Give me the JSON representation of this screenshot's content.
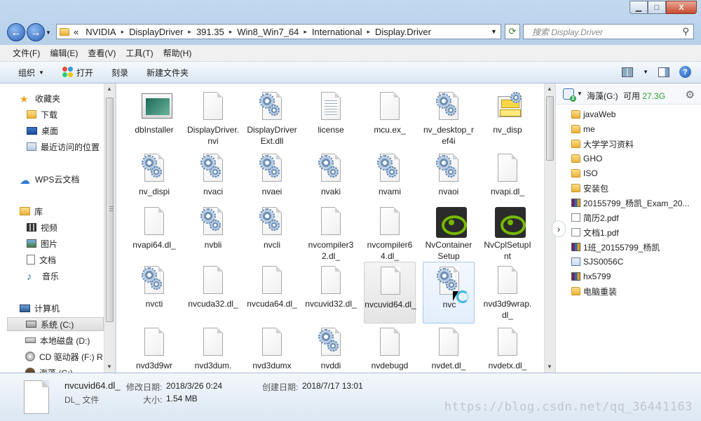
{
  "window": {
    "controls": {
      "minimize": "▁",
      "maximize": "□",
      "close": "X"
    }
  },
  "nav": {
    "back": "←",
    "forward": "→"
  },
  "address": {
    "overflow": "«",
    "segments": [
      "NVIDIA",
      "DisplayDriver",
      "391.35",
      "Win8_Win7_64",
      "International",
      "Display.Driver"
    ],
    "separator": "▸"
  },
  "search": {
    "placeholder": "搜索 Display.Driver"
  },
  "menu": [
    "文件(F)",
    "编辑(E)",
    "查看(V)",
    "工具(T)",
    "帮助(H)"
  ],
  "toolbar": {
    "organize": "组织",
    "open": "打开",
    "burn": "刻录",
    "new_folder": "新建文件夹",
    "help": "?"
  },
  "navpane": {
    "favorites": "收藏夹",
    "downloads": "下载",
    "desktop": "桌面",
    "recent": "最近访问的位置",
    "wps_cloud": "WPS云文档",
    "libraries": "库",
    "videos": "视频",
    "pictures": "图片",
    "documents": "文档",
    "music": "音乐",
    "computer": "计算机",
    "drive_c": "系统 (C:)",
    "drive_d": "本地磁盘 (D:)",
    "drive_f": "CD 驱动器 (F:) R",
    "drive_g": "海藻 (G:)"
  },
  "files": [
    {
      "name": "dbInstaller",
      "icon": "installer-icon"
    },
    {
      "name": "DisplayDriver.nvi",
      "icon": "document-icon"
    },
    {
      "name": "DisplayDriverExt.dll",
      "icon": "dll-icon"
    },
    {
      "name": "license",
      "icon": "text-icon"
    },
    {
      "name": "mcu.ex_",
      "icon": "document-icon"
    },
    {
      "name": "nv_desktop_ref4i",
      "icon": "dll-icon"
    },
    {
      "name": "nv_disp",
      "icon": "setup-info-icon"
    },
    {
      "name": "nv_dispi",
      "icon": "dll-icon"
    },
    {
      "name": "nvaci",
      "icon": "dll-icon"
    },
    {
      "name": "nvaei",
      "icon": "dll-icon"
    },
    {
      "name": "nvaki",
      "icon": "dll-icon"
    },
    {
      "name": "nvami",
      "icon": "dll-icon"
    },
    {
      "name": "nvaoi",
      "icon": "dll-icon"
    },
    {
      "name": "nvapi.dl_",
      "icon": "document-icon"
    },
    {
      "name": "nvapi64.dl_",
      "icon": "document-icon"
    },
    {
      "name": "nvbli",
      "icon": "dll-icon"
    },
    {
      "name": "nvcli",
      "icon": "dll-icon"
    },
    {
      "name": "nvcompiler32.dl_",
      "icon": "document-icon"
    },
    {
      "name": "nvcompiler64.dl_",
      "icon": "document-icon"
    },
    {
      "name": "NvContainerSetup",
      "icon": "nvidia-icon"
    },
    {
      "name": "NvCplSetupInt",
      "icon": "nvidia-icon"
    },
    {
      "name": "nvcti",
      "icon": "dll-icon"
    },
    {
      "name": "nvcuda32.dl_",
      "icon": "document-icon"
    },
    {
      "name": "nvcuda64.dl_",
      "icon": "document-icon"
    },
    {
      "name": "nvcuvid32.dl_",
      "icon": "document-icon"
    },
    {
      "name": "nvcuvid64.dl_",
      "icon": "document-icon"
    },
    {
      "name": "nvc",
      "icon": "dll-icon"
    },
    {
      "name": "nvd3d9wrap.dl_",
      "icon": "document-icon"
    },
    {
      "name": "nvd3d9wr",
      "icon": "document-icon"
    },
    {
      "name": "nvd3dum.",
      "icon": "document-icon"
    },
    {
      "name": "nvd3dumx",
      "icon": "document-icon"
    },
    {
      "name": "nvddi",
      "icon": "dll-icon"
    },
    {
      "name": "nvdebugd",
      "icon": "document-icon"
    },
    {
      "name": "nvdet.dl_",
      "icon": "document-icon"
    },
    {
      "name": "nvdetx.dl_",
      "icon": "document-icon"
    }
  ],
  "selected_file_index": 25,
  "hovered_file_index": 26,
  "cloud_panel": {
    "drive_name": "海藻(G:)",
    "available_label": "可用",
    "available_value": "27.3G",
    "items": [
      {
        "name": "javaWeb",
        "type": "folder"
      },
      {
        "name": "me",
        "type": "folder"
      },
      {
        "name": "大学学习资料",
        "type": "folder"
      },
      {
        "name": "GHO",
        "type": "folder"
      },
      {
        "name": "ISO",
        "type": "folder"
      },
      {
        "name": "安装包",
        "type": "folder"
      },
      {
        "name": "20155799_杨凯_Exam_20...",
        "type": "archive"
      },
      {
        "name": "简历2.pdf",
        "type": "pdf"
      },
      {
        "name": "文档1.pdf",
        "type": "pdf"
      },
      {
        "name": "1班_20155799_杨凯",
        "type": "archive"
      },
      {
        "name": "SJS0056C",
        "type": "config"
      },
      {
        "name": "hx5799",
        "type": "archive"
      },
      {
        "name": "电脑重装",
        "type": "folder"
      }
    ]
  },
  "details": {
    "filename": "nvcuvid64.dl_",
    "modified_label": "修改日期:",
    "modified_value": "2018/3/26 0:24",
    "created_label": "创建日期:",
    "created_value": "2018/7/17 13:01",
    "type": "DL_ 文件",
    "size_label": "大小:",
    "size_value": "1.54 MB"
  },
  "watermark": "https://blog.csdn.net/qq_36441163",
  "colors": {
    "nvidia_green": "#76b900",
    "available_green": "#2e9f2e",
    "titlebar": "#c2d9f0"
  }
}
